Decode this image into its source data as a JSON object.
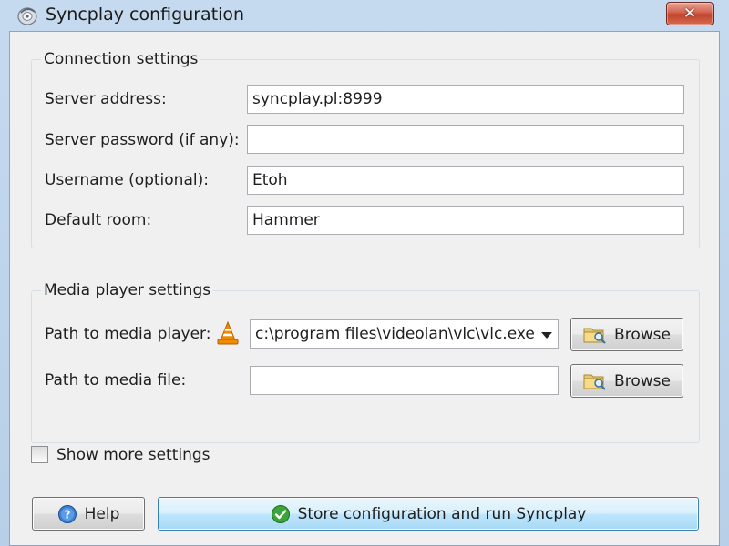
{
  "window": {
    "title": "Syncplay configuration",
    "close_glyph": "✕"
  },
  "connection": {
    "group_title": "Connection settings",
    "server_address_label": "Server address:",
    "server_address_value": "syncplay.pl:8999",
    "server_password_label": "Server password (if any):",
    "server_password_value": "",
    "username_label": "Username (optional):",
    "username_value": "Etoh",
    "default_room_label": "Default room:",
    "default_room_value": "Hammer"
  },
  "media": {
    "group_title": "Media player settings",
    "player_path_label": "Path to media player:",
    "player_path_value": "c:\\program files\\videolan\\vlc\\vlc.exe",
    "player_icon": "vlc-cone-icon",
    "file_path_label": "Path to media file:",
    "file_path_value": "",
    "browse_label": "Browse",
    "browse_label_2": "Browse"
  },
  "options": {
    "show_more_label": "Show more settings",
    "show_more_checked": false
  },
  "footer": {
    "help_label": "Help",
    "run_label": "Store configuration and run Syncplay"
  },
  "colors": {
    "title_bar": "#c6daef",
    "close_button": "#c0442d",
    "default_button": "#bee6fd",
    "vlc_orange": "#f08a00"
  }
}
